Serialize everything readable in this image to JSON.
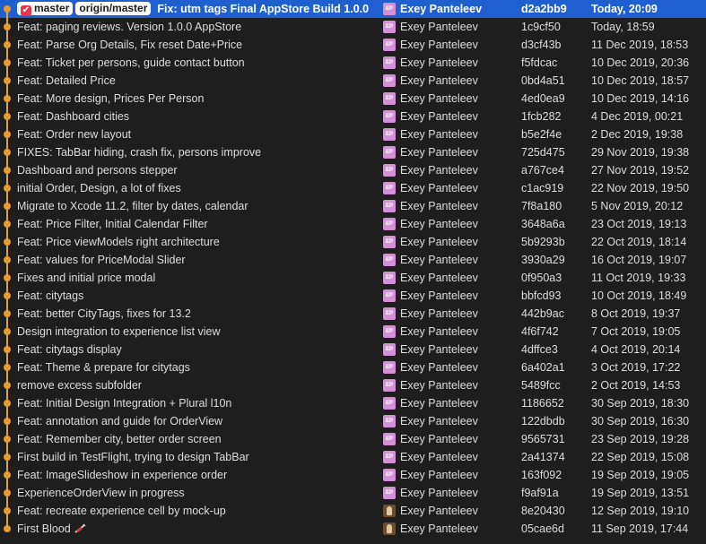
{
  "commits": [
    {
      "message": "Fix: utm tags Final AppStore Build 1.0.0",
      "tags": [
        {
          "label": "master",
          "kind": "local"
        },
        {
          "label": "origin/master",
          "kind": "remote"
        }
      ],
      "avatar": "EP",
      "author": "Exey Panteleev",
      "hash": "d2a2bb9",
      "date": "Today, 20:09",
      "selected": true
    },
    {
      "message": "Feat: paging reviews. Version 1.0.0 AppStore",
      "avatar": "EP",
      "author": "Exey Panteleev",
      "hash": "1c9cf50",
      "date": "Today, 18:59"
    },
    {
      "message": "Feat: Parse Org Details, Fix reset Date+Price",
      "avatar": "EP",
      "author": "Exey Panteleev",
      "hash": "d3cf43b",
      "date": "11 Dec 2019, 18:53"
    },
    {
      "message": "Feat: Ticket per persons, guide contact button",
      "avatar": "EP",
      "author": "Exey Panteleev",
      "hash": "f5fdcac",
      "date": "10 Dec 2019, 20:36"
    },
    {
      "message": "Feat: Detailed Price",
      "avatar": "EP",
      "author": "Exey Panteleev",
      "hash": "0bd4a51",
      "date": "10 Dec 2019, 18:57"
    },
    {
      "message": "Feat: More design, Prices Per Person",
      "avatar": "EP",
      "author": "Exey Panteleev",
      "hash": "4ed0ea9",
      "date": "10 Dec 2019, 14:16"
    },
    {
      "message": "Feat: Dashboard cities",
      "avatar": "EP",
      "author": "Exey Panteleev",
      "hash": "1fcb282",
      "date": "4 Dec 2019, 00:21"
    },
    {
      "message": "Feat: Order new layout",
      "avatar": "EP",
      "author": "Exey Panteleev",
      "hash": "b5e2f4e",
      "date": "2 Dec 2019, 19:38"
    },
    {
      "message": "FIXES: TabBar hiding, crash fix, persons improve",
      "avatar": "EP",
      "author": "Exey Panteleev",
      "hash": "725d475",
      "date": "29 Nov 2019, 19:38"
    },
    {
      "message": "Dashboard and persons stepper",
      "avatar": "EP",
      "author": "Exey Panteleev",
      "hash": "a767ce4",
      "date": "27 Nov 2019, 19:52"
    },
    {
      "message": "initial Order, Design, a lot of fixes",
      "avatar": "EP",
      "author": "Exey Panteleev",
      "hash": "c1ac919",
      "date": "22 Nov 2019, 19:50"
    },
    {
      "message": "Migrate to Xcode 11.2, filter by dates, calendar",
      "avatar": "EP",
      "author": "Exey Panteleev",
      "hash": "7f8a180",
      "date": "5 Nov 2019, 20:12"
    },
    {
      "message": "Feat: Price Filter, Initial Calendar Filter",
      "avatar": "EP",
      "author": "Exey Panteleev",
      "hash": "3648a6a",
      "date": "23 Oct 2019, 19:13"
    },
    {
      "message": "Feat: Price viewModels right architecture",
      "avatar": "EP",
      "author": "Exey Panteleev",
      "hash": "5b9293b",
      "date": "22 Oct 2019, 18:14"
    },
    {
      "message": "Feat: values for PriceModal Slider",
      "avatar": "EP",
      "author": "Exey Panteleev",
      "hash": "3930a29",
      "date": "16 Oct 2019, 19:07"
    },
    {
      "message": "Fixes and initial price modal",
      "avatar": "EP",
      "author": "Exey Panteleev",
      "hash": "0f950a3",
      "date": "11 Oct 2019, 19:33"
    },
    {
      "message": "Feat: citytags",
      "avatar": "EP",
      "author": "Exey Panteleev",
      "hash": "bbfcd93",
      "date": "10 Oct 2019, 18:49"
    },
    {
      "message": "Feat: better CityTags, fixes for 13.2",
      "avatar": "EP",
      "author": "Exey Panteleev",
      "hash": "442b9ac",
      "date": "8 Oct 2019, 19:37"
    },
    {
      "message": "Design integration to experience list view",
      "avatar": "EP",
      "author": "Exey Panteleev",
      "hash": "4f6f742",
      "date": "7 Oct 2019, 19:05"
    },
    {
      "message": "Feat: citytags display",
      "avatar": "EP",
      "author": "Exey Panteleev",
      "hash": "4dffce3",
      "date": "4 Oct 2019, 20:14"
    },
    {
      "message": "Feat: Theme & prepare for citytags",
      "avatar": "EP",
      "author": "Exey Panteleev",
      "hash": "6a402a1",
      "date": "3 Oct 2019, 17:22"
    },
    {
      "message": "remove excess subfolder",
      "avatar": "EP",
      "author": "Exey Panteleev",
      "hash": "5489fcc",
      "date": "2 Oct 2019, 14:53"
    },
    {
      "message": "Feat: Initial Design Integration + Plural l10n",
      "avatar": "EP",
      "author": "Exey Panteleev",
      "hash": "1186652",
      "date": "30 Sep 2019, 18:30"
    },
    {
      "message": "Feat: annotation and guide for OrderView",
      "avatar": "EP",
      "author": "Exey Panteleev",
      "hash": "122dbdb",
      "date": "30 Sep 2019, 16:30"
    },
    {
      "message": "Feat: Remember city, better order screen",
      "avatar": "EP",
      "author": "Exey Panteleev",
      "hash": "9565731",
      "date": "23 Sep 2019, 19:28"
    },
    {
      "message": "First build in TestFlight, trying to design TabBar",
      "avatar": "EP",
      "author": "Exey Panteleev",
      "hash": "2a41374",
      "date": "22 Sep 2019, 15:08"
    },
    {
      "message": "Feat: ImageSlideshow in experience order",
      "avatar": "EP",
      "author": "Exey Panteleev",
      "hash": "163f092",
      "date": "19 Sep 2019, 19:05"
    },
    {
      "message": "ExperienceOrderView in progress",
      "avatar": "EP",
      "author": "Exey Panteleev",
      "hash": "f9af91a",
      "date": "19 Sep 2019, 13:51"
    },
    {
      "message": "Feat: recreate experience cell by mock-up",
      "avatar": "photo",
      "author": "Exey Panteleev",
      "hash": "8e20430",
      "date": "12 Sep 2019, 19:10"
    },
    {
      "message": "First Blood",
      "avatar": "photo",
      "icon": "syringe-icon",
      "author": "Exey Panteleev",
      "hash": "05cae6d",
      "date": "11 Sep 2019, 17:44"
    }
  ],
  "colors": {
    "background": "#1e1e1e",
    "selection": "#1f5fd0",
    "graph": "#e89a34",
    "avatar": "#d690d9",
    "branch_check": "#e8354a"
  }
}
